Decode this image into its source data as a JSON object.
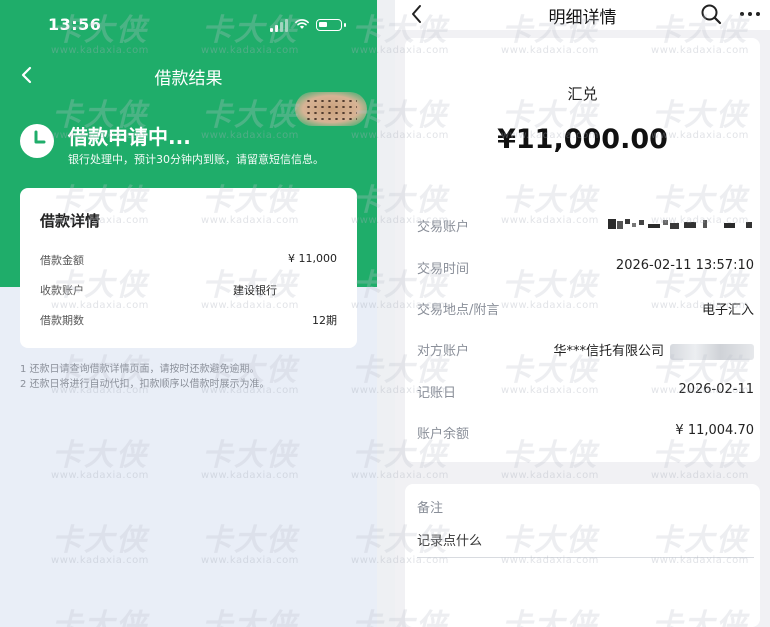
{
  "left_screen": {
    "status_bar": {
      "time": "13:56"
    },
    "nav": {
      "title": "借款结果"
    },
    "status": {
      "title": "借款申请中...",
      "description": "银行处理中，预计30分钟内到账，请留意短信信息。"
    },
    "detail_card": {
      "title": "借款详情",
      "rows": [
        {
          "label": "借款金额",
          "value": "¥ 11,000"
        },
        {
          "label": "收款账户",
          "value": "建设银行"
        },
        {
          "label": "借款期数",
          "value": "12期"
        }
      ]
    },
    "notes": [
      "1 还款日请查询借款详情页面，请按时还款避免逾期。",
      "2 还款日将进行自动代扣，扣款顺序以借款时展示为准。"
    ]
  },
  "right_screen": {
    "nav": {
      "title": "明细详情"
    },
    "transaction": {
      "type": "汇兑",
      "amount": "¥11,000.00",
      "rows": [
        {
          "label": "交易账户",
          "value": ""
        },
        {
          "label": "交易时间",
          "value": "2026-02-11 13:57:10"
        },
        {
          "label": "交易地点/附言",
          "value": "电子汇入"
        },
        {
          "label": "对方账户",
          "value": "华***信托有限公司"
        },
        {
          "label": "记账日",
          "value": "2026-02-11"
        },
        {
          "label": "账户余额",
          "value": "¥ 11,004.70"
        }
      ]
    },
    "memo": {
      "label": "备注",
      "placeholder": "记录点什么"
    }
  },
  "watermark": {
    "brand": "卡大侠",
    "url": "www.kadaxia.com"
  },
  "colors": {
    "primary_green": "#1fad6a",
    "page_bg": "#e9eef7"
  }
}
